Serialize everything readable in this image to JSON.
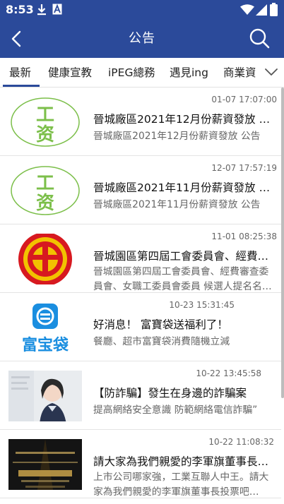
{
  "status_bar": {
    "time": "8:53"
  },
  "header": {
    "title": "公告",
    "back_icon": "chevron-left-icon",
    "search_icon": "search-icon",
    "bg_color": "#2b4a9a"
  },
  "tabs": [
    {
      "label": "最新",
      "active": true
    },
    {
      "label": "健康宣教",
      "active": false
    },
    {
      "label": "iPEG總務",
      "active": false
    },
    {
      "label": "遇見ing",
      "active": false
    },
    {
      "label": "商業資",
      "active": false
    }
  ],
  "news": [
    {
      "time": "01-07 17:07:00",
      "title": "晉城廠區2021年12月份薪資發放 公告",
      "summary": "晉城廠區2021年12月份薪資發放 公告",
      "thumb_text": [
        "工",
        "资"
      ],
      "thumb_icon": "salary-badge-icon"
    },
    {
      "time": "12-07 17:57:19",
      "title": "晉城廠區2021年11月份薪資發放 公告",
      "summary": "晉城廠區2021年11月份薪資發放 公告",
      "thumb_text": [
        "工",
        "资"
      ],
      "thumb_icon": "salary-badge-icon"
    },
    {
      "time": "11-01 08:25:38",
      "title": "晉城園區第四屆工會委員會、經費審…",
      "summary": "晉城園區第四屆工會委員會、經費審查委員會、女職工委員會委員 候選人提名名…",
      "thumb_icon": "trade-union-emblem-icon"
    },
    {
      "time": "10-23 15:31:45",
      "title": "好消息！ 富寶袋送福利了！",
      "summary": "餐廳、超市富寶袋消費隨機立減",
      "thumb_text": [
        "富宝袋"
      ],
      "thumb_icon": "fubaodai-logo-icon"
    },
    {
      "time": "10-22 13:45:58",
      "title": "【防詐騙】發生在身邊的詐騙案",
      "summary": "提高網絡安全意識 防範網絡電信詐騙”",
      "thumb_icon": "police-officer-photo"
    },
    {
      "time": "10-22 11:08:32",
      "title": "請大家為我們親愛的李軍旗董事長投…",
      "summary": "上市公司哪家強，工業互聯人中王。請大家為我們親愛的李軍旗董事長投票吧…",
      "thumb_icon": "award-banner-photo"
    }
  ]
}
